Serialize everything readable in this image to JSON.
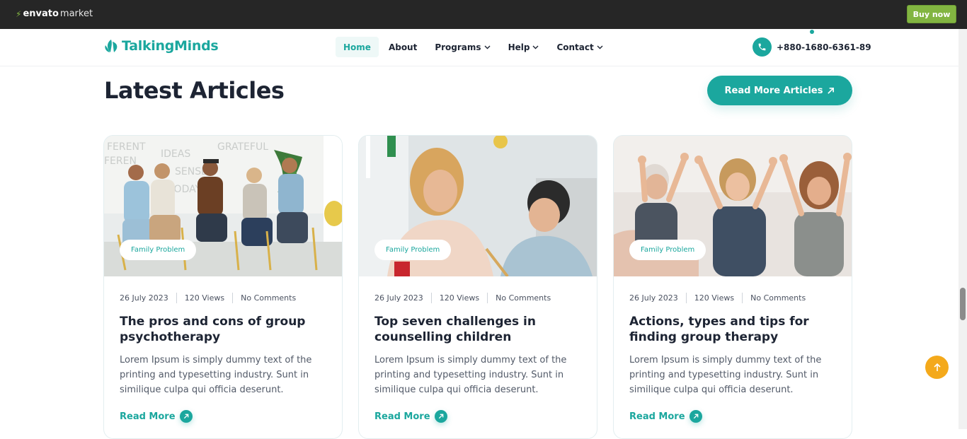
{
  "envato": {
    "logo_brand": "envato",
    "logo_suffix": "market",
    "buy_now": "Buy now"
  },
  "header": {
    "brand": "TalkingMinds",
    "nav": [
      {
        "label": "Home",
        "active": true
      },
      {
        "label": "About"
      },
      {
        "label": "Programs",
        "dropdown": true
      },
      {
        "label": "Help",
        "dropdown": true
      },
      {
        "label": "Contact",
        "dropdown": true
      }
    ],
    "phone": "+880-1680-6361-89"
  },
  "section": {
    "title": "Latest Articles",
    "cta": "Read More Articles"
  },
  "articles": [
    {
      "tag": "Family Problem",
      "date": "26 July 2023",
      "views": "120 Views",
      "comments": "No Comments",
      "title": "The pros and cons of group psychotherapy",
      "excerpt": "Lorem Ipsum is simply dummy text of the printing and typesetting industry. Sunt in similique culpa qui officia deserunt.",
      "link": "Read More"
    },
    {
      "tag": "Family Problem",
      "date": "26 July 2023",
      "views": "120 Views",
      "comments": "No Comments",
      "title": "Top seven challenges in counselling children",
      "excerpt": "Lorem Ipsum is simply dummy text of the printing and typesetting industry. Sunt in similique culpa qui officia deserunt.",
      "link": "Read More"
    },
    {
      "tag": "Family Problem",
      "date": "26 July 2023",
      "views": "120 Views",
      "comments": "No Comments",
      "title": "Actions, types and tips for finding group therapy",
      "excerpt": "Lorem Ipsum is simply dummy text of the printing and typesetting industry. Sunt in similique culpa qui officia deserunt.",
      "link": "Read More"
    }
  ],
  "colors": {
    "brand": "#1ba79e",
    "envato_green": "#82b541",
    "back_to_top": "#f4a91b",
    "text_dark": "#1d2433"
  },
  "icons": {
    "phone": "phone-icon",
    "arrow_up_right": "arrow-up-right-icon",
    "chevron": "chevron-down-icon",
    "back_to_top": "arrow-up-icon"
  }
}
